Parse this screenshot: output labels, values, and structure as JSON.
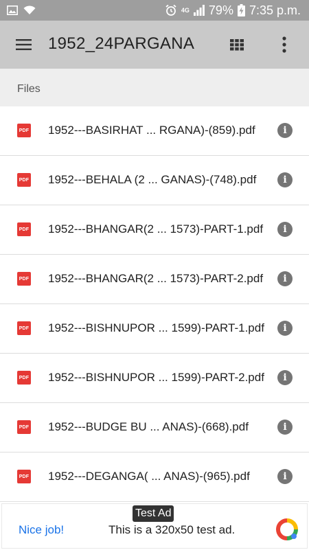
{
  "status_bar": {
    "network_type": "4G",
    "battery_percent": "79%",
    "time": "7:35 p.m.",
    "icons": [
      "image-notification-icon",
      "wifi-icon",
      "alarm-icon",
      "signal-icon",
      "battery-charging-icon"
    ]
  },
  "app_bar": {
    "title": "1952_24PARGANA",
    "menu_icon": "hamburger-menu-icon",
    "grid_icon": "grid-view-icon",
    "more_icon": "more-vert-icon",
    "background": "#c9c9c9"
  },
  "section": {
    "label": "Files"
  },
  "files": [
    {
      "name": "1952---BASIRHAT ... RGANA)-(859).pdf",
      "icon_label": "PDF"
    },
    {
      "name": "1952---BEHALA (2 ... GANAS)-(748).pdf",
      "icon_label": "PDF"
    },
    {
      "name": "1952---BHANGAR(2 ... 1573)-PART-1.pdf",
      "icon_label": "PDF"
    },
    {
      "name": "1952---BHANGAR(2 ... 1573)-PART-2.pdf",
      "icon_label": "PDF"
    },
    {
      "name": "1952---BISHNUPOR ... 1599)-PART-1.pdf",
      "icon_label": "PDF"
    },
    {
      "name": "1952---BISHNUPOR ... 1599)-PART-2.pdf",
      "icon_label": "PDF"
    },
    {
      "name": "1952---BUDGE BU ... ANAS)-(668).pdf",
      "icon_label": "PDF"
    },
    {
      "name": "1952---DEGANGA( ... ANAS)-(965).pdf",
      "icon_label": "PDF"
    }
  ],
  "info_glyph": "i",
  "ad": {
    "badge": "Test Ad",
    "cta": "Nice job!",
    "text": "This is a 320x50 test ad.",
    "cta_color": "#1a73e8"
  },
  "colors": {
    "pdf_red": "#e53935",
    "info_gray": "#757575",
    "section_bg": "#eeeeee"
  }
}
